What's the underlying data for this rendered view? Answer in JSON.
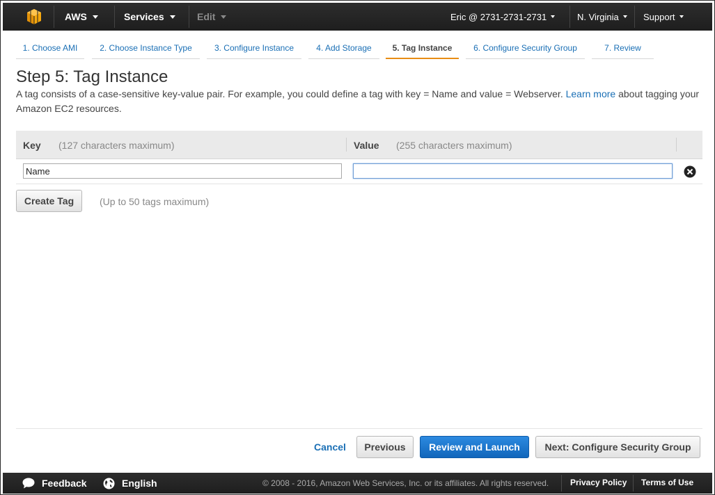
{
  "nav": {
    "brand": "AWS",
    "services": "Services",
    "edit": "Edit",
    "account": "Eric @ 2731-2731-2731",
    "region": "N. Virginia",
    "support": "Support"
  },
  "wizard_tabs": [
    {
      "label": "1. Choose AMI",
      "active": false
    },
    {
      "label": "2. Choose Instance Type",
      "active": false
    },
    {
      "label": "3. Configure Instance",
      "active": false
    },
    {
      "label": "4. Add Storage",
      "active": false
    },
    {
      "label": "5. Tag Instance",
      "active": true
    },
    {
      "label": "6. Configure Security Group",
      "active": false
    },
    {
      "label": "7. Review",
      "active": false
    }
  ],
  "page": {
    "title": "Step 5: Tag Instance",
    "description_before": "A tag consists of a case-sensitive key-value pair. For example, you could define a tag with key = Name and value = Webserver. ",
    "description_link": "Learn more",
    "description_after": " about tagging your Amazon EC2 resources."
  },
  "table": {
    "key_header": "Key",
    "key_hint": "(127 characters maximum)",
    "value_header": "Value",
    "value_hint": "(255 characters maximum)",
    "rows": [
      {
        "key": "Name",
        "value": ""
      }
    ]
  },
  "create_tag": {
    "label": "Create Tag",
    "hint": "(Up to 50 tags maximum)"
  },
  "actions": {
    "cancel": "Cancel",
    "previous": "Previous",
    "review_launch": "Review and Launch",
    "next": "Next: Configure Security Group"
  },
  "footer": {
    "feedback": "Feedback",
    "language": "English",
    "copyright": "© 2008 - 2016, Amazon Web Services, Inc. or its affiliates. All rights reserved.",
    "privacy": "Privacy Policy",
    "terms": "Terms of Use"
  },
  "colors": {
    "nav_bg": "#232323",
    "link": "#1a6fb5",
    "active_tab_underline": "#e88d14",
    "primary_button": "#1f7bd0",
    "cube": "#f7a80d"
  },
  "icons": {
    "logo": "aws-cube-icon",
    "remove": "remove-circle-icon",
    "feedback": "speech-bubble-icon",
    "language": "globe-icon"
  }
}
